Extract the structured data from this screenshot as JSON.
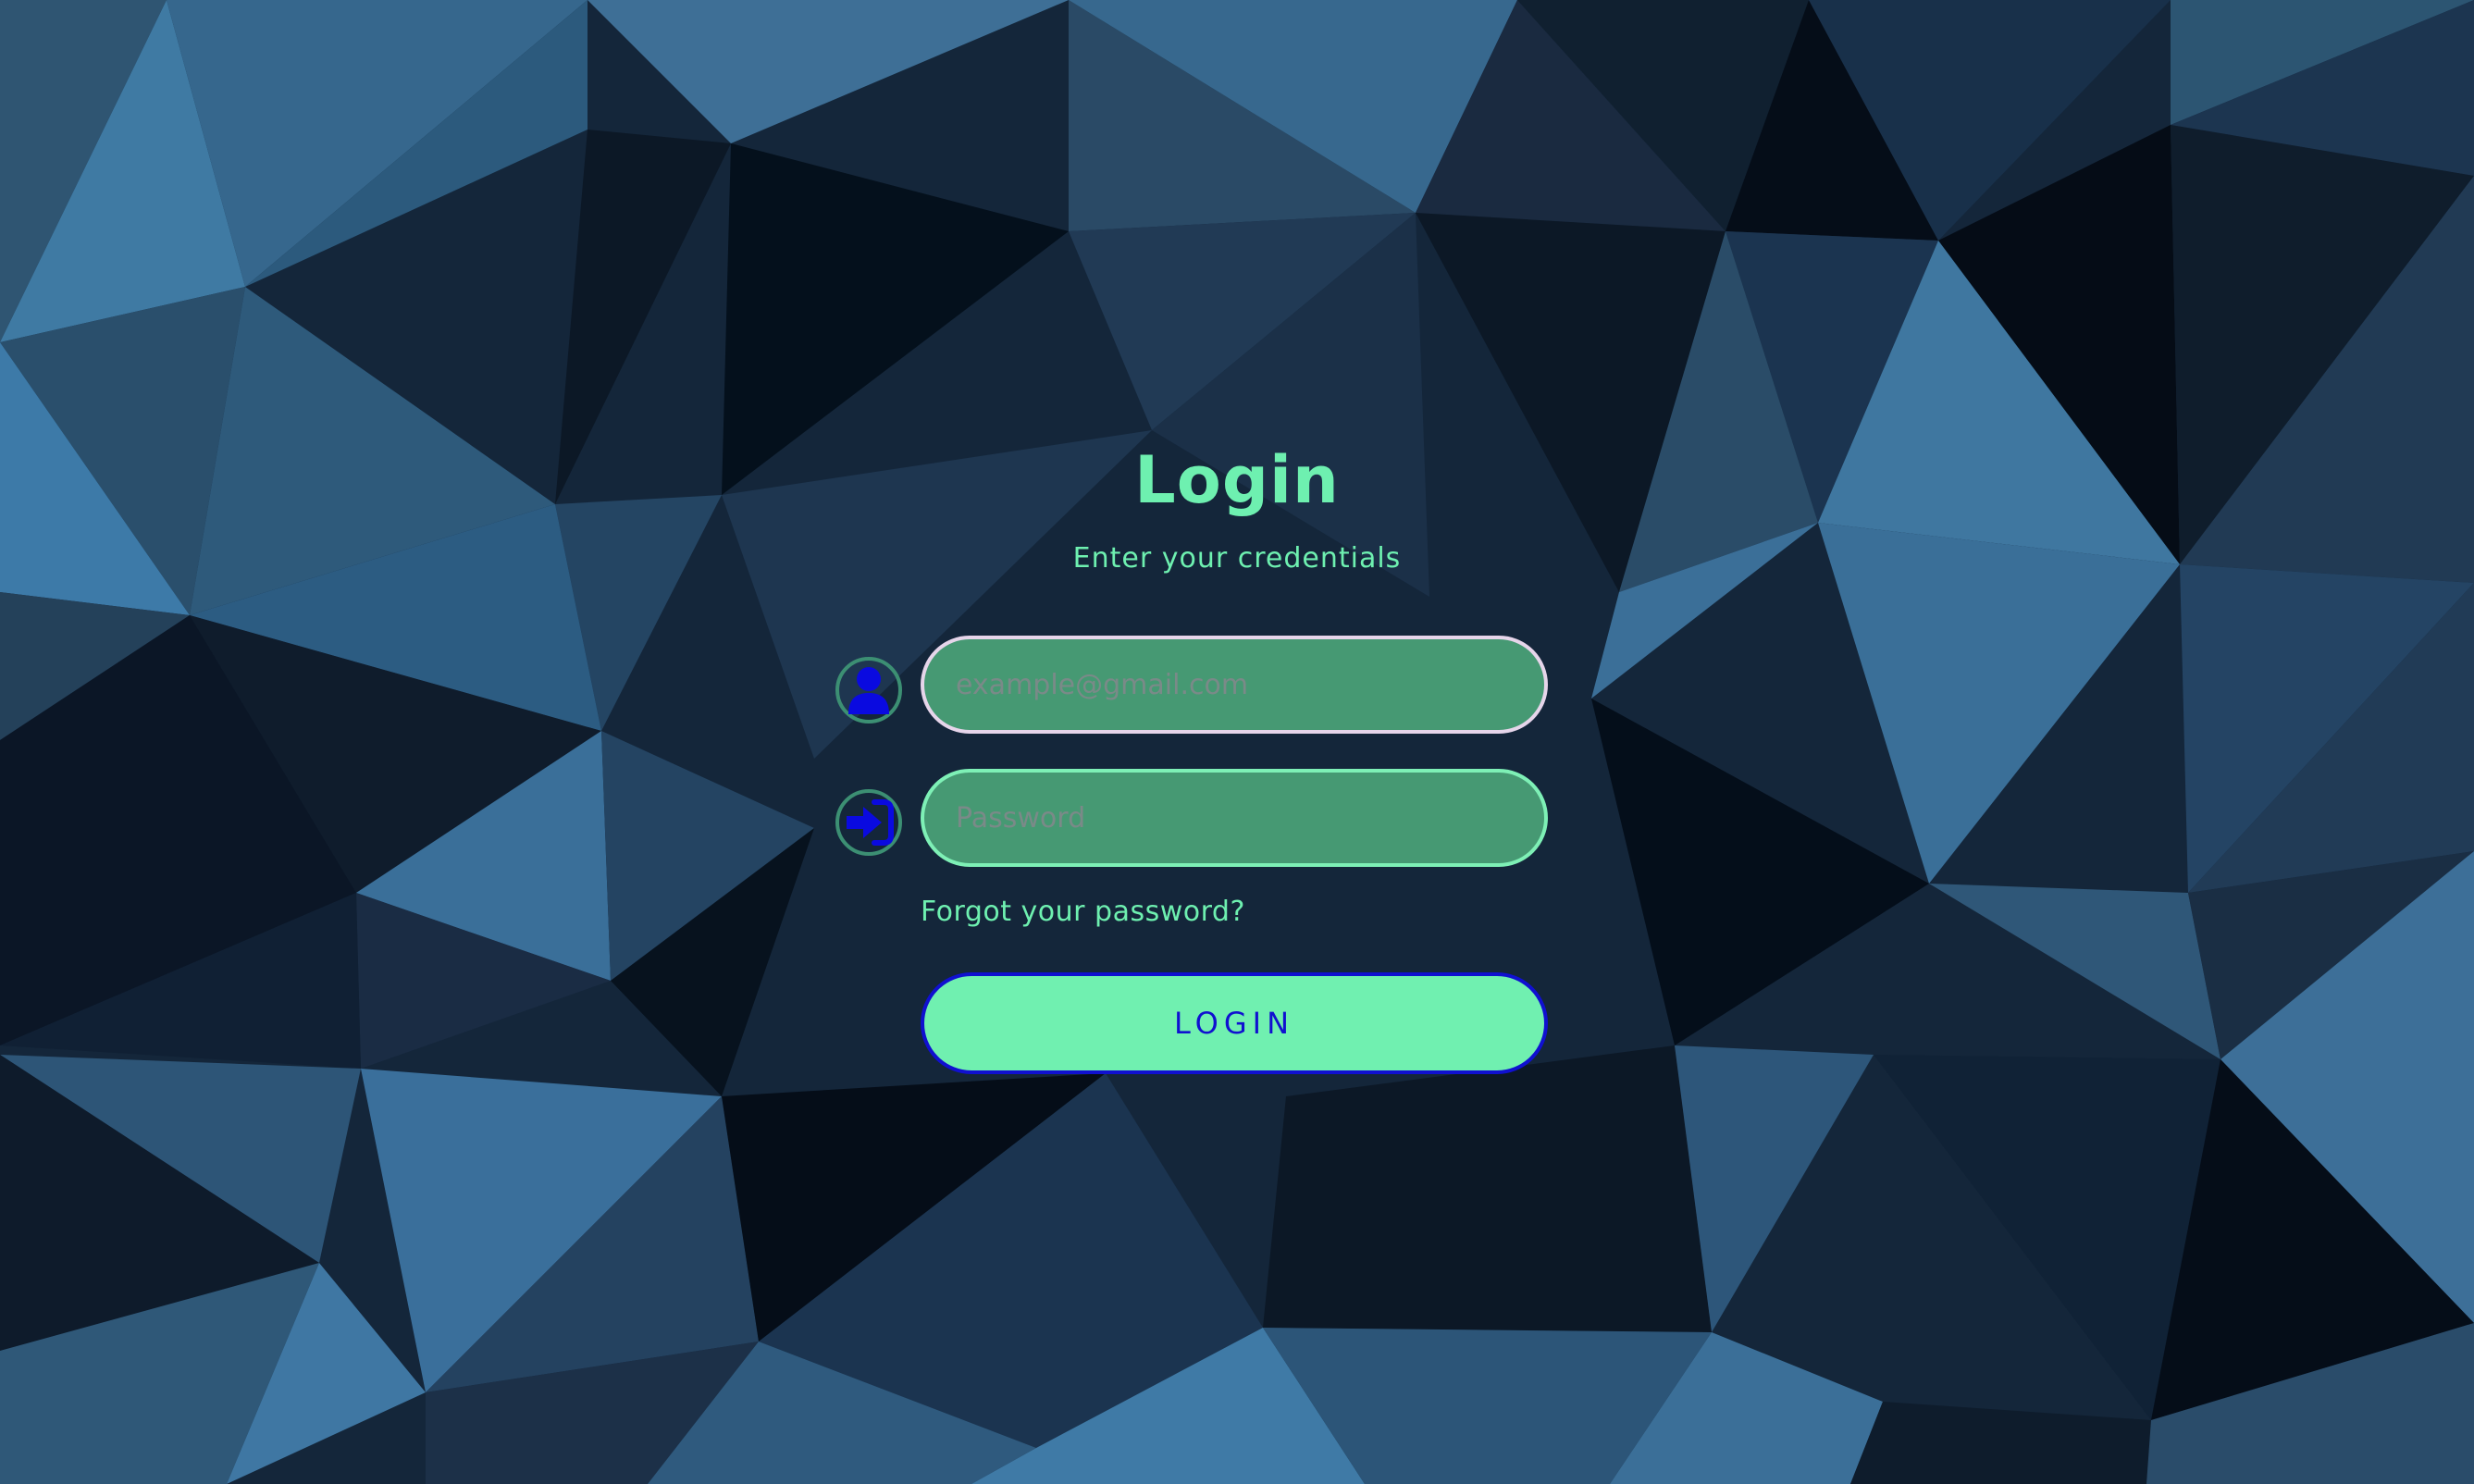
{
  "login": {
    "title": "Login",
    "subtitle": "Enter your credentials",
    "email_placeholder": "example@gmail.com",
    "password_placeholder": "Password",
    "forgot_link": "Forgot your password?",
    "submit_label": "LOGIN"
  },
  "icons": {
    "email": "user-icon",
    "password": "sign-in-icon"
  },
  "colors": {
    "accent": "#6ef0b0",
    "button_text": "#1010d0",
    "icon_fill": "#0a0ae0"
  }
}
